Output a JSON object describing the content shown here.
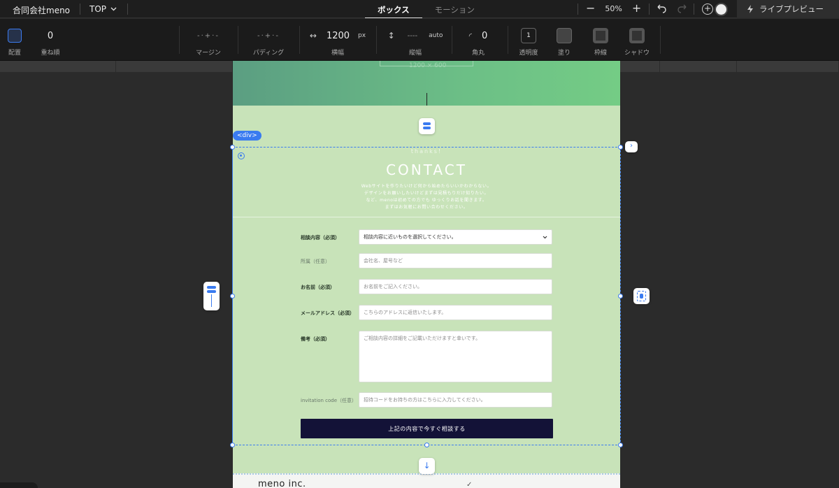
{
  "topbar": {
    "company": "合同会社meno",
    "page_selector": "TOP",
    "tabs": [
      "ボックス",
      "モーション"
    ],
    "zoom": "50%",
    "zoom_out_symbol": "−",
    "zoom_in_symbol": "+",
    "live_preview": "ライブプレビュー"
  },
  "properties": {
    "layout_label": "配置",
    "z_order_value": "0",
    "z_order_label": "重ね順",
    "margin_label": "マージン",
    "padding_label": "パディング",
    "width_value": "1200",
    "width_unit": "px",
    "width_label": "横幅",
    "height_value": "----",
    "height_unit": "auto",
    "height_label": "縦幅",
    "radius_value": "0",
    "radius_label": "角丸",
    "opacity_value": "1",
    "opacity_label": "透明度",
    "fill_label": "塗り",
    "border_label": "枠線",
    "shadow_label": "シャドウ"
  },
  "canvas": {
    "selection_tag": "<div>",
    "hero_size_caption": "1200 × 600",
    "section": {
      "eyebrow": "thanks!",
      "title": "CONTACT",
      "lead": [
        "Webサイトを作りたいけど何から始めたらいいかわからない。",
        "デザインをお願いしたいけどまずは見積もりだけ知りたい。",
        "など、menoは初めての方でも ゆっくりお話を聞きます。",
        "まずはお気軽にお問い合わせください。"
      ]
    },
    "form": {
      "rows": [
        {
          "label": "相談内容（必須）",
          "value": "相談内容に近いものを選択してください。",
          "kind": "select",
          "required": true
        },
        {
          "label": "所属（任意）",
          "value": "会社名、屋号など",
          "kind": "input",
          "required": false
        },
        {
          "label": "お名前（必須）",
          "value": "お名前をご記入ください。",
          "kind": "input",
          "required": true
        },
        {
          "label": "メールアドレス（必須）",
          "value": "こちらのアドレスに返信いたします。",
          "kind": "input",
          "required": true
        },
        {
          "label": "備考（必須）",
          "value": "ご相談内容の詳細をご記載いただけますと幸いです。",
          "kind": "textarea",
          "required": true
        },
        {
          "label": "invitation code（任意）",
          "value": "招待コードをお持ちの方はこちらに入力してください。",
          "kind": "input",
          "required": false
        }
      ],
      "submit": "上記の内容で今すぐ相談する"
    },
    "footer": {
      "logo": "meno inc."
    }
  },
  "colors": {
    "accent": "#3a7bf0",
    "page_bg": "#c8e3b9",
    "submit_bg": "#131237",
    "hero_start": "#5b9e82",
    "hero_end": "#74cc85"
  }
}
